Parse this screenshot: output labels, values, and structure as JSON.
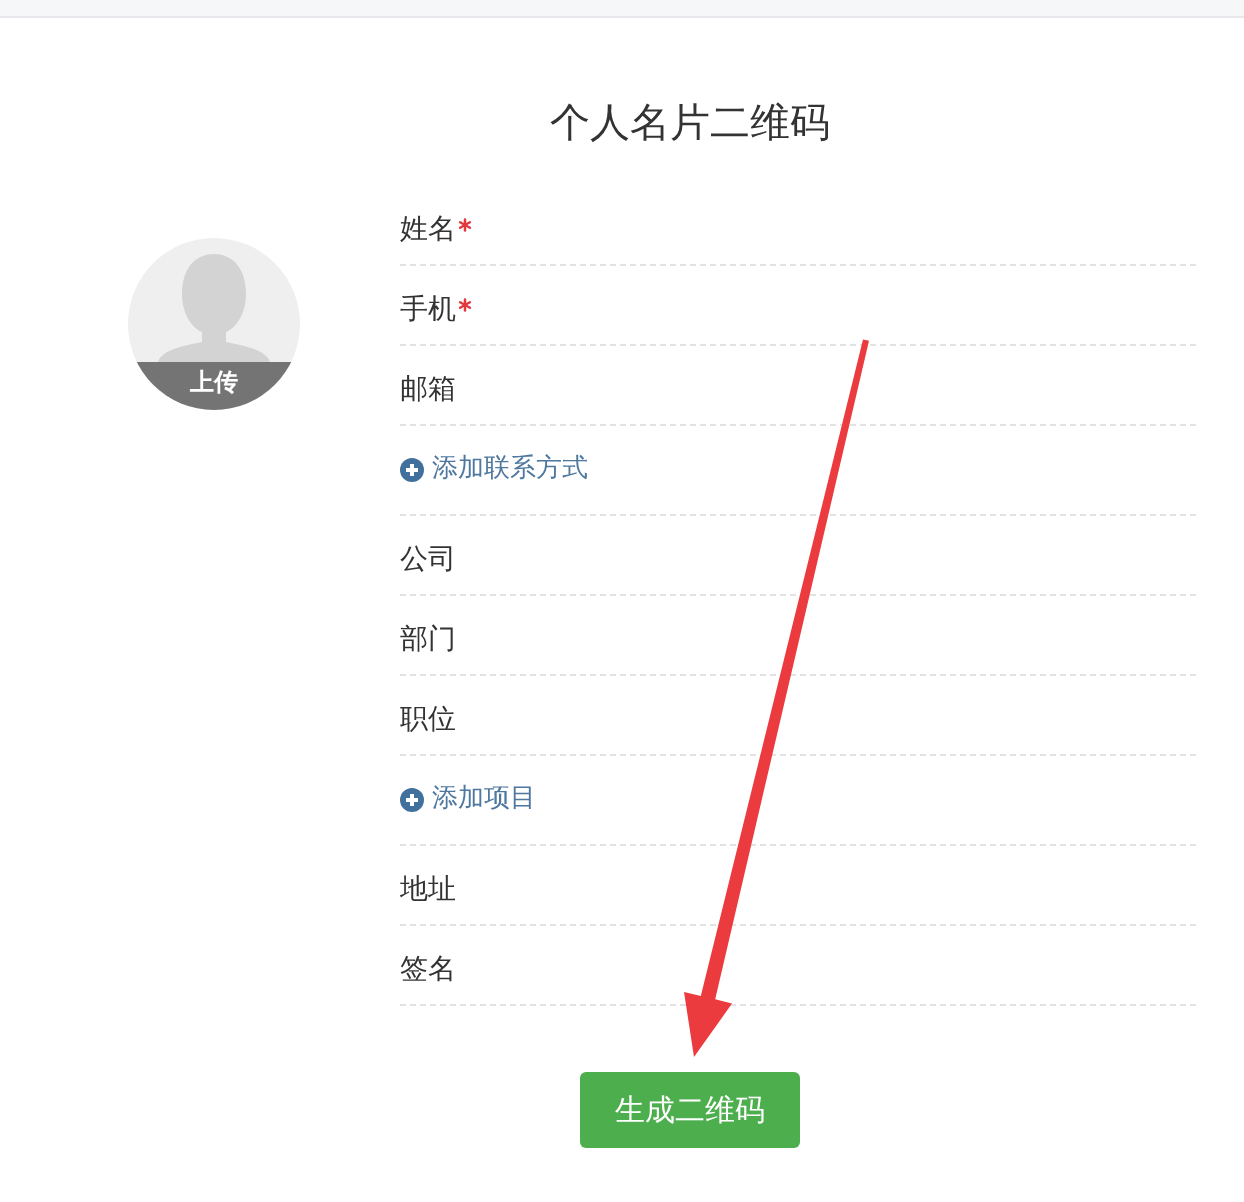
{
  "title": "个人名片二维码",
  "avatar": {
    "upload_label": "上传"
  },
  "form": {
    "rows": [
      {
        "kind": "field",
        "label": "姓名",
        "required": true
      },
      {
        "kind": "field",
        "label": "手机",
        "required": true
      },
      {
        "kind": "field",
        "label": "邮箱",
        "required": false
      },
      {
        "kind": "add",
        "label": "添加联系方式"
      },
      {
        "kind": "field",
        "label": "公司",
        "required": false
      },
      {
        "kind": "field",
        "label": "部门",
        "required": false
      },
      {
        "kind": "field",
        "label": "职位",
        "required": false
      },
      {
        "kind": "add",
        "label": "添加项目"
      },
      {
        "kind": "field",
        "label": "地址",
        "required": false
      },
      {
        "kind": "field",
        "label": "签名",
        "required": false
      }
    ]
  },
  "submit_button": "生成二维码"
}
